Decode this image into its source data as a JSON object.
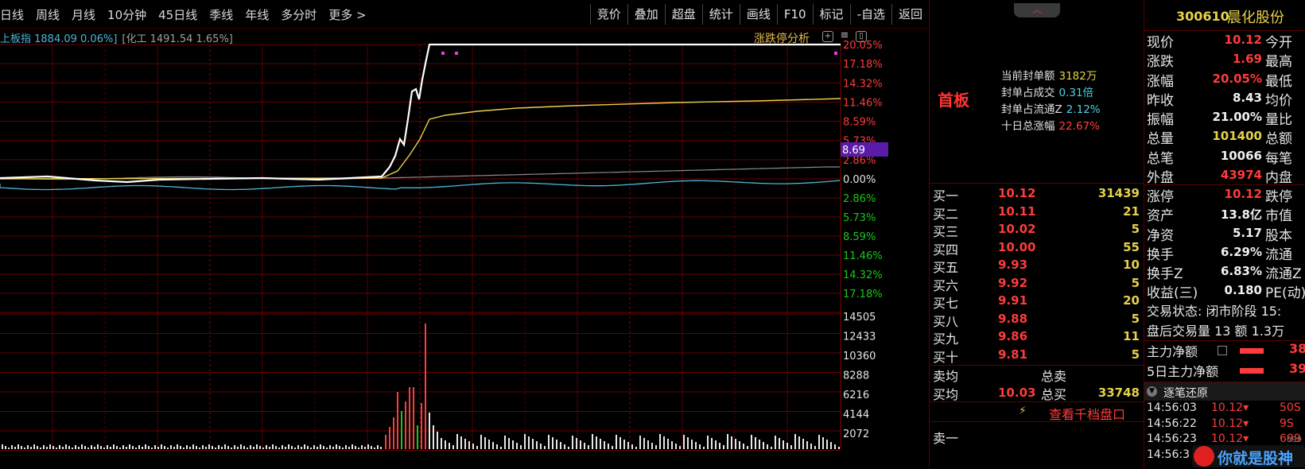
{
  "toolbar": {
    "periods": [
      "日线",
      "周线",
      "月线",
      "10分钟",
      "45日线",
      "季线",
      "年线",
      "多分时",
      "更多 >"
    ],
    "tools": [
      "竞价",
      "叠加",
      "超盘",
      "统计",
      "画线",
      "F10",
      "标记",
      "-自选",
      "返回"
    ]
  },
  "indexbar": {
    "index1": "上板指 1884.09 0.06%]",
    "index2": "[化工 1491.54 1.65%]",
    "limit_analysis": "涨跌停分析"
  },
  "chart_data": {
    "type": "line",
    "price_axis_labels_up": [
      "20.05%",
      "17.18%",
      "14.32%",
      "11.46%",
      "8.59%",
      "5.73%",
      "2.86%"
    ],
    "zero_label": "0.00%",
    "price_axis_labels_down": [
      "2.86%",
      "5.73%",
      "8.59%",
      "11.46%",
      "14.32%",
      "17.18%"
    ],
    "volume_axis_labels": [
      "14505",
      "12433",
      "10360",
      "8288",
      "6216",
      "4144",
      "2072"
    ],
    "cursor_value": "8.69",
    "colors": {
      "price": "#ffffff",
      "avg": "#e6d14a",
      "index": "#4fb6d8",
      "grid": "#6a0000",
      "up": "#ff3b3b",
      "down": "#19c819",
      "cursor": "#5a1ca8"
    }
  },
  "seal": {
    "title": "首板",
    "rows": [
      {
        "label": "当前封单额",
        "value": "3182万",
        "cls": "v-y"
      },
      {
        "label": "封单占成交",
        "value": "0.31倍",
        "cls": "v-c"
      },
      {
        "label": "封单占流通Z",
        "value": "2.12%",
        "cls": "v-c"
      },
      {
        "label": "十日总涨幅",
        "value": "22.67%",
        "cls": "v-r"
      }
    ]
  },
  "book": [
    {
      "label": "买一",
      "price": "10.12",
      "vol": "31439"
    },
    {
      "label": "买二",
      "price": "10.11",
      "vol": "21"
    },
    {
      "label": "买三",
      "price": "10.02",
      "vol": "5"
    },
    {
      "label": "买四",
      "price": "10.00",
      "vol": "55"
    },
    {
      "label": "买五",
      "price": "9.93",
      "vol": "10"
    },
    {
      "label": "买六",
      "price": "9.92",
      "vol": "5"
    },
    {
      "label": "买七",
      "price": "9.91",
      "vol": "20"
    },
    {
      "label": "买八",
      "price": "9.88",
      "vol": "5"
    },
    {
      "label": "买九",
      "price": "9.86",
      "vol": "11"
    },
    {
      "label": "买十",
      "price": "9.81",
      "vol": "5"
    }
  ],
  "avg": {
    "sell_avg_label": "卖均",
    "sell_total_label": "总卖",
    "buy_avg_label": "买均",
    "buy_avg": "10.03",
    "buy_total_label": "总买",
    "buy_total": "33748"
  },
  "depth_link": "查看千档盘口",
  "sell1": "卖一",
  "stock": {
    "code": "300610",
    "name": "晨化股份"
  },
  "quote": [
    {
      "l": "现价",
      "v": "10.12",
      "c": "red",
      "r": "今开"
    },
    {
      "l": "涨跌",
      "v": "1.69",
      "c": "red",
      "r": "最高"
    },
    {
      "l": "涨幅",
      "v": "20.05%",
      "c": "red",
      "r": "最低"
    },
    {
      "l": "昨收",
      "v": "8.43",
      "c": "wht",
      "r": "均价"
    },
    {
      "l": "振幅",
      "v": "21.00%",
      "c": "wht",
      "r": "量比"
    },
    {
      "l": "总量",
      "v": "101400",
      "c": "yel",
      "r": "总额"
    },
    {
      "l": "总笔",
      "v": "10066",
      "c": "wht",
      "r": "每笔"
    },
    {
      "l": "外盘",
      "v": "43974",
      "c": "red",
      "r": "内盘"
    }
  ],
  "quote2": [
    {
      "l": "涨停",
      "v": "10.12",
      "c": "red",
      "r": "跌停"
    },
    {
      "l": "资产",
      "v": "13.8亿",
      "c": "wht",
      "r": "市值"
    },
    {
      "l": "净资",
      "v": "5.17",
      "c": "wht",
      "r": "股本"
    },
    {
      "l": "换手",
      "v": "6.29%",
      "c": "wht",
      "r": "流通"
    },
    {
      "l": "换手Z",
      "v": "6.83%",
      "c": "wht",
      "r": "流通Z"
    },
    {
      "l": "收益(三)",
      "v": "0.180",
      "c": "wht",
      "r": "PE(动)"
    }
  ],
  "trade_state": [
    "交易状态: 闭市阶段 15:",
    "盘后交易量 13 额 1.3万"
  ],
  "flows": [
    {
      "l": "主力净额",
      "v": "38"
    },
    {
      "l": "5日主力净额",
      "v": "39"
    }
  ],
  "ticks_title": "逐笔还原",
  "ticks": [
    {
      "t": "14:56:03",
      "p": "10.12▾",
      "v": "50S"
    },
    {
      "t": "14:56:22",
      "p": "10.12▾",
      "v": "9S"
    },
    {
      "t": "14:56:23",
      "p": "10.12▾",
      "v": "699"
    },
    {
      "t": "14:56:3",
      "p": "",
      "v": ""
    }
  ],
  "watermark": {
    "text": "你就是股神",
    "small": "699"
  }
}
